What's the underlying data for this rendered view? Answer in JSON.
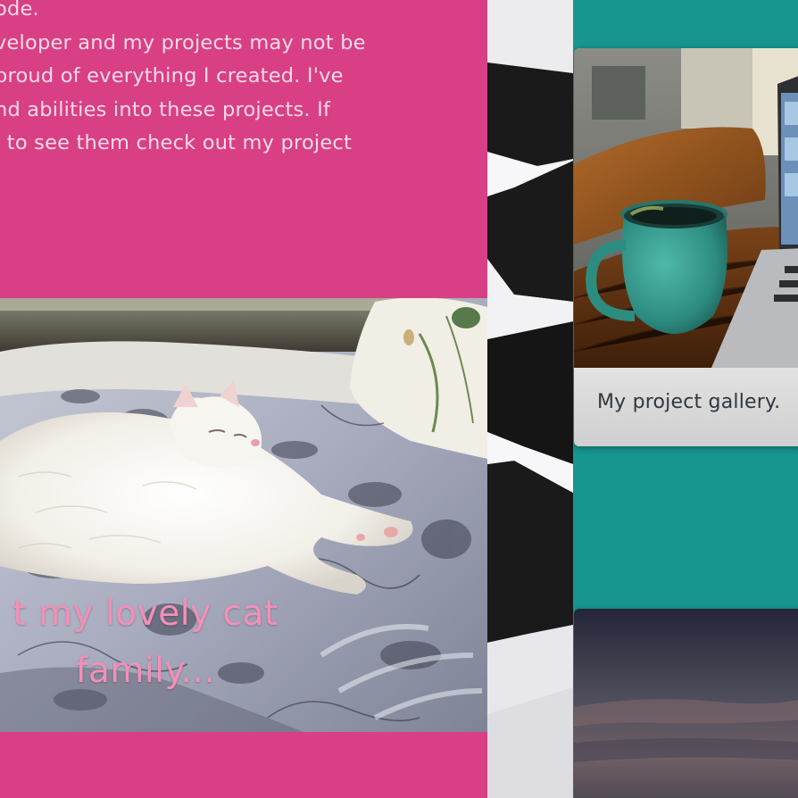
{
  "about": {
    "text_lines": [
      "ode.",
      "veloper and my projects may not be",
      "proud of everything I created. I've",
      "nd abilities into these projects. If",
      "l to see them check out my project"
    ]
  },
  "cat_section": {
    "caption_lines": [
      "t my lovely cat",
      "family..."
    ]
  },
  "gallery": {
    "caption": "My project gallery."
  },
  "colors": {
    "pink": "#d93f85",
    "teal": "#17968f",
    "caption_pink": "#f48fb8"
  }
}
